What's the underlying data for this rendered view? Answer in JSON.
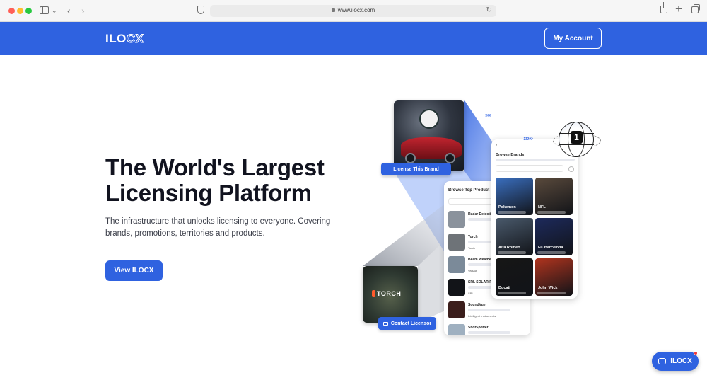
{
  "browser": {
    "url": "www.ilocx.com"
  },
  "header": {
    "logo_solid": "ILO",
    "logo_outline": "CX",
    "account_label": "My Account"
  },
  "hero": {
    "title_line1": "The World's Largest",
    "title_line2": "Licensing Platform",
    "subtitle": "The infrastructure that unlocks licensing to everyone. Covering brands, promotions, territories and products.",
    "cta_label": "View ILOCX"
  },
  "illustration": {
    "license_label": "License This Brand",
    "contact_label": "Contact Licensor",
    "torch_label": "TORCH",
    "globe_number": "1",
    "product_list": {
      "title": "Browse Top Product Id",
      "items": [
        {
          "name": "Radar Detection"
        },
        {
          "name": "Torch",
          "meta": "Torch"
        },
        {
          "name": "Beam Weather S",
          "meta": "Vaisala"
        },
        {
          "name": "SRL SOLAR PLU",
          "meta": "SRL"
        },
        {
          "name": "SoundVue",
          "meta": "Intelligent Instruments"
        },
        {
          "name": "ShotSpotter"
        }
      ]
    },
    "brands": {
      "title": "Browse Brands",
      "tiles": [
        {
          "label": "Pokemon",
          "color": "#3a6fc0"
        },
        {
          "label": "NFL",
          "color": "#5a4a3c"
        },
        {
          "label": "Alfa Romeo",
          "color": "#4a5a6c"
        },
        {
          "label": "FC Barcelona",
          "color": "#1d2a5c"
        },
        {
          "label": "Ducati",
          "color": "#161616"
        },
        {
          "label": "John Wick",
          "color": "#b0341e"
        }
      ]
    }
  },
  "chat": {
    "label": "ILOCX"
  }
}
